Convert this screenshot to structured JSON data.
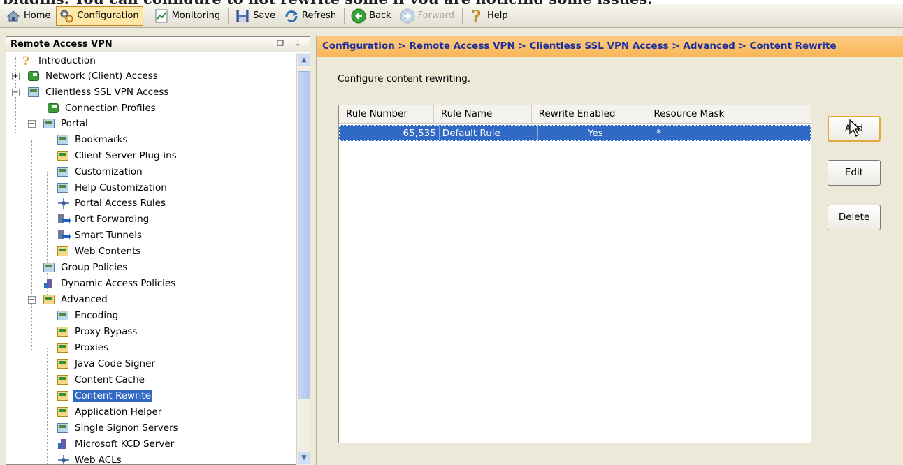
{
  "caption": "plugins. You can configure to not rewrite some if you are noticing some issues.",
  "toolbar": {
    "home": "Home",
    "configuration": "Configuration",
    "monitoring": "Monitoring",
    "save": "Save",
    "refresh": "Refresh",
    "back": "Back",
    "forward": "Forward",
    "help": "Help"
  },
  "left_pane": {
    "title": "Remote Access VPN",
    "pins": "❐ ↓",
    "tree": [
      {
        "label": "Introduction"
      },
      {
        "label": "Network (Client) Access"
      },
      {
        "label": "Clientless SSL VPN Access"
      },
      {
        "label": "Connection Profiles"
      },
      {
        "label": "Portal"
      },
      {
        "label": "Bookmarks"
      },
      {
        "label": "Client-Server Plug-ins"
      },
      {
        "label": "Customization"
      },
      {
        "label": "Help Customization"
      },
      {
        "label": "Portal Access Rules"
      },
      {
        "label": "Port Forwarding"
      },
      {
        "label": "Smart Tunnels"
      },
      {
        "label": "Web Contents"
      },
      {
        "label": "Group Policies"
      },
      {
        "label": "Dynamic Access Policies"
      },
      {
        "label": "Advanced"
      },
      {
        "label": "Encoding"
      },
      {
        "label": "Proxy Bypass"
      },
      {
        "label": "Proxies"
      },
      {
        "label": "Java Code Signer"
      },
      {
        "label": "Content Cache"
      },
      {
        "label": "Content Rewrite"
      },
      {
        "label": "Application Helper"
      },
      {
        "label": "Single Signon Servers"
      },
      {
        "label": "Microsoft KCD Server"
      },
      {
        "label": "Web ACLs"
      }
    ],
    "selected": "Content Rewrite"
  },
  "breadcrumb": {
    "configuration": "Configuration",
    "remote_access_vpn": "Remote Access VPN",
    "clientless": "Clientless SSL VPN Access",
    "advanced": "Advanced",
    "current": "Content Rewrite",
    "sep": " > "
  },
  "main": {
    "description": "Configure content rewriting.",
    "table": {
      "headers": [
        "Rule Number",
        "Rule Name",
        "Rewrite Enabled",
        "Resource Mask"
      ],
      "rows": [
        {
          "rule_number": "65,535",
          "rule_name": "Default Rule",
          "rewrite_enabled": "Yes",
          "resource_mask": "*"
        }
      ]
    },
    "buttons": {
      "add": "Add",
      "edit": "Edit",
      "delete": "Delete"
    }
  },
  "colors": {
    "selection": "#316ac5",
    "breadcrumb_bg": "#fbc06b",
    "breadcrumb_text": "#1a2fa0",
    "active_tool": "#ffe7a8"
  }
}
